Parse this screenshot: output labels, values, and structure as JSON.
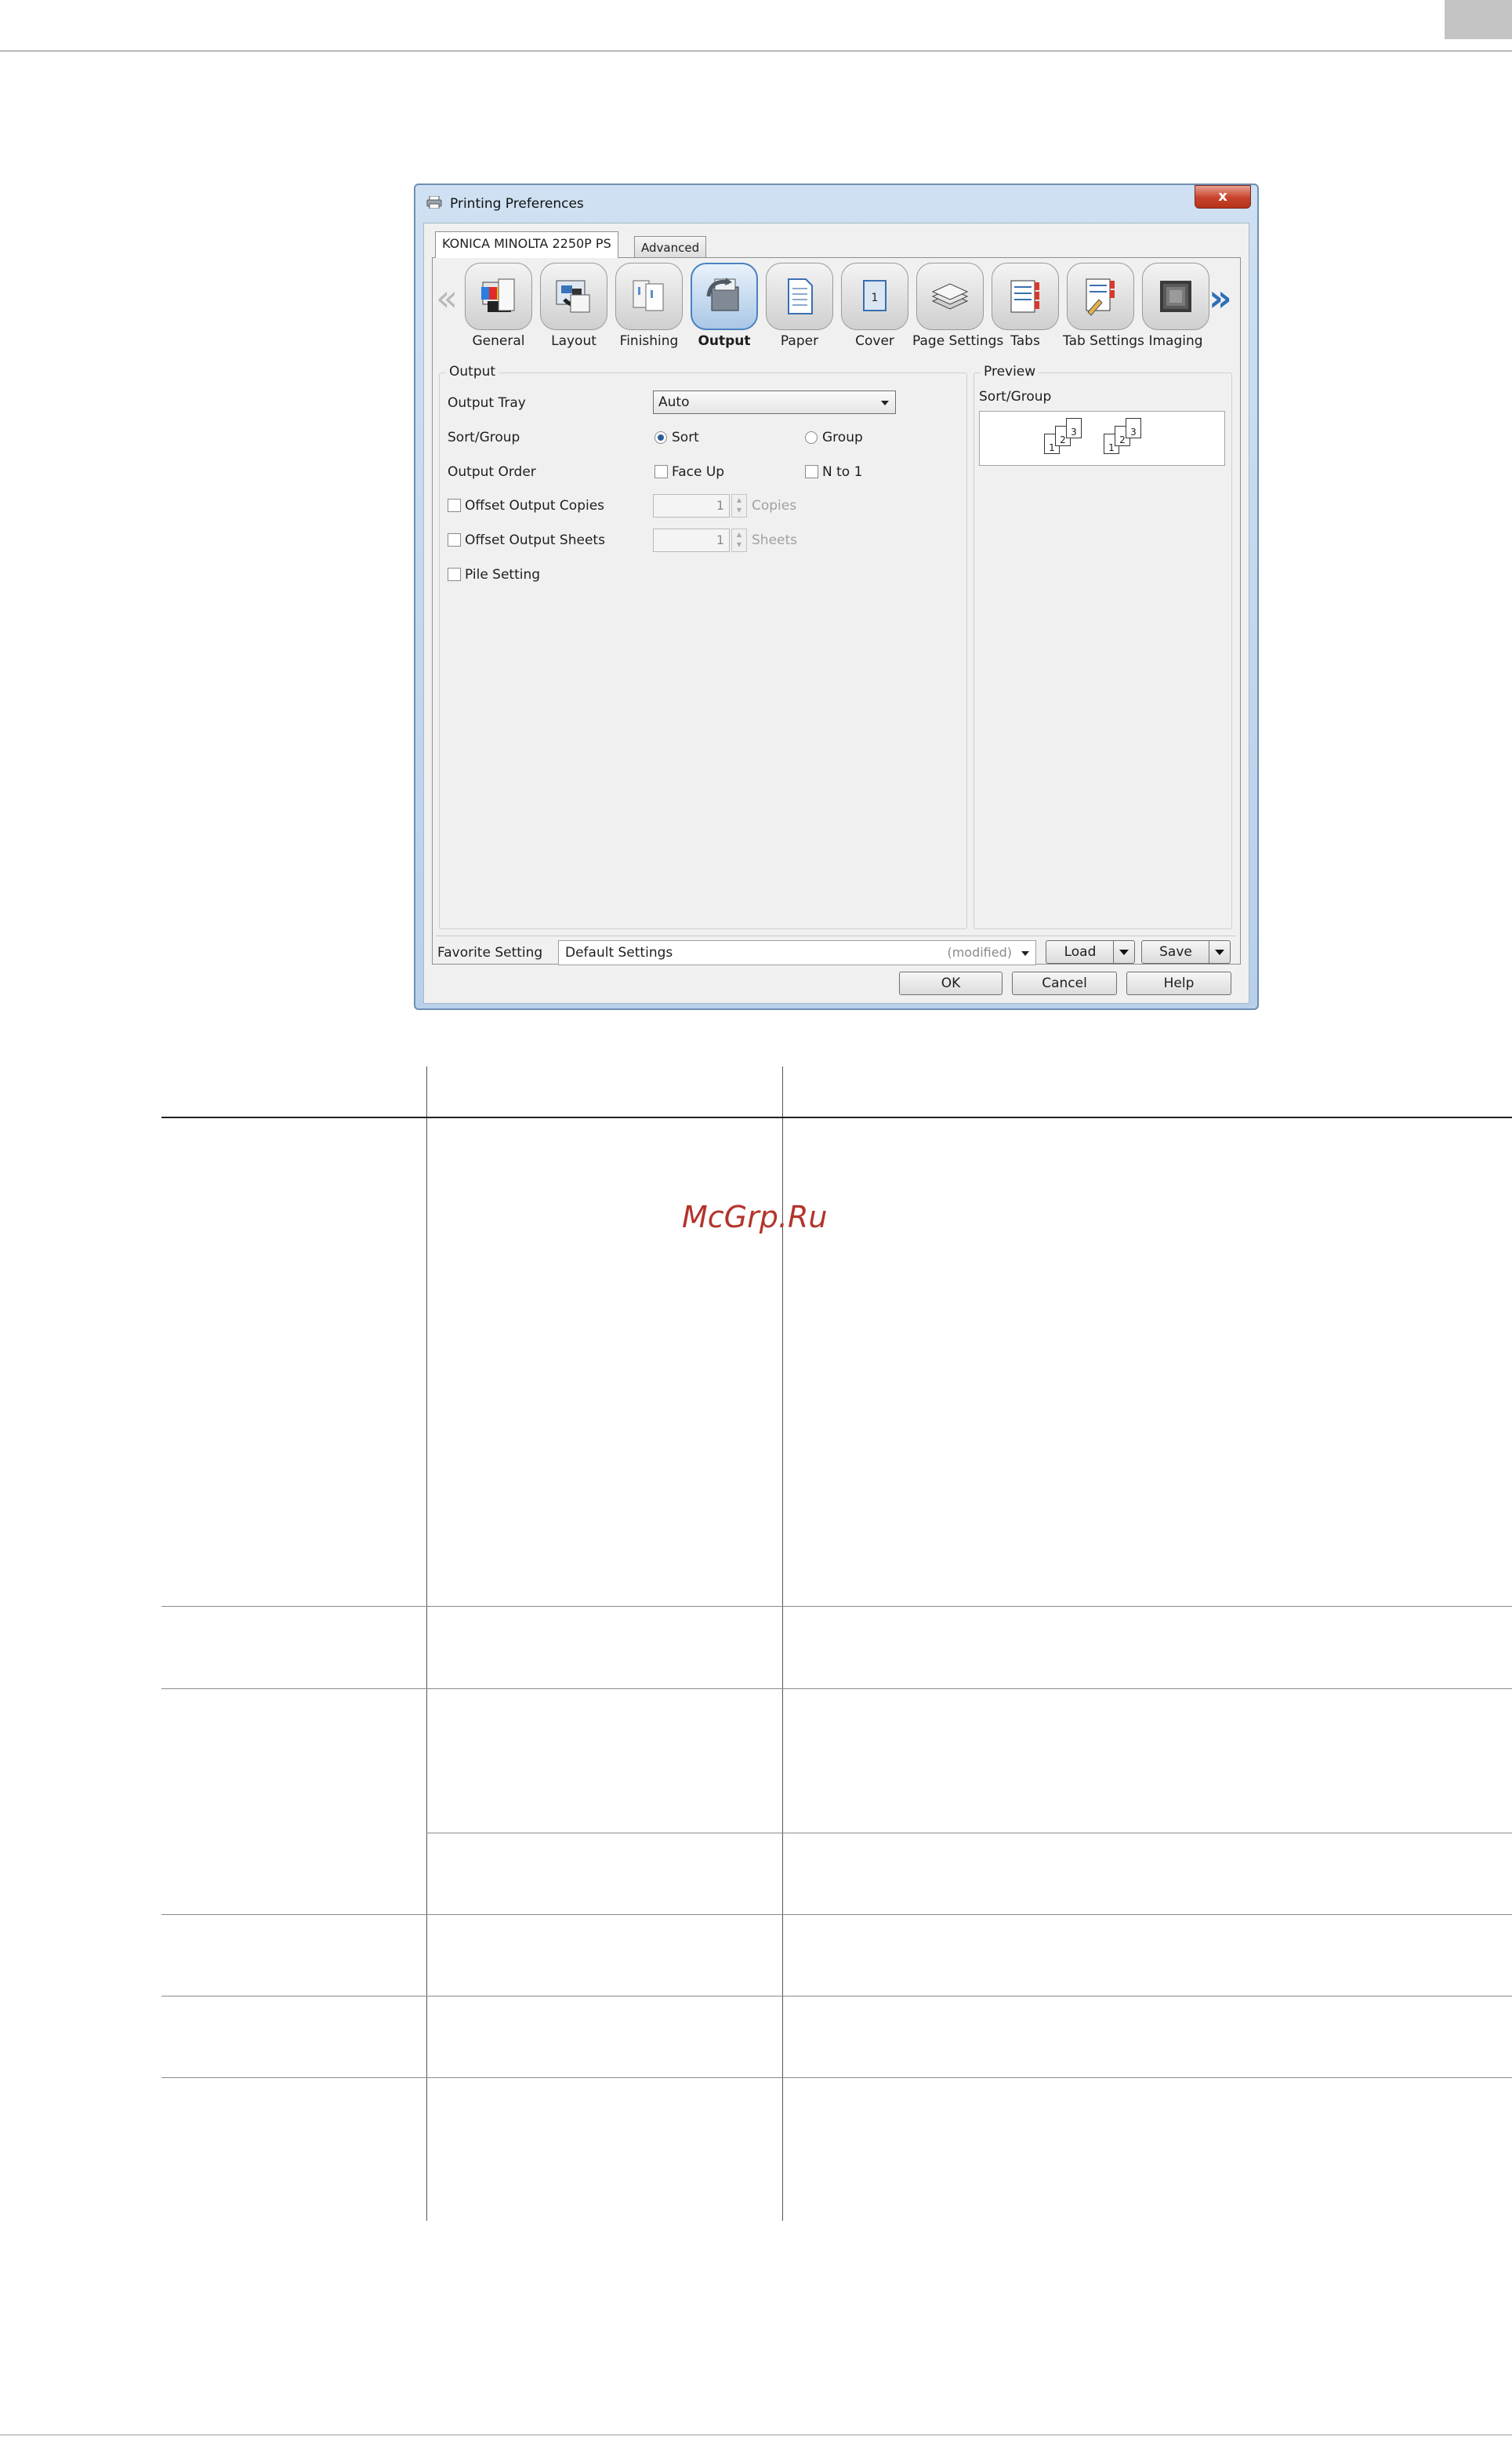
{
  "dialog": {
    "title": "Printing Preferences",
    "close_label": "x",
    "tabs": [
      "KONICA MINOLTA 2250P PS",
      "Advanced"
    ],
    "categories": [
      {
        "label": "General",
        "icon": "general-icon",
        "selected": false
      },
      {
        "label": "Layout",
        "icon": "layout-icon",
        "selected": false
      },
      {
        "label": "Finishing",
        "icon": "finishing-icon",
        "selected": false
      },
      {
        "label": "Output",
        "icon": "output-icon",
        "selected": true
      },
      {
        "label": "Paper",
        "icon": "paper-icon",
        "selected": false
      },
      {
        "label": "Cover",
        "icon": "cover-icon",
        "selected": false
      },
      {
        "label": "Page Settings",
        "icon": "page-settings-icon",
        "selected": false
      },
      {
        "label": "Tabs",
        "icon": "tabs-icon",
        "selected": false
      },
      {
        "label": "Tab Settings",
        "icon": "tab-settings-icon",
        "selected": false
      },
      {
        "label": "Imaging",
        "icon": "imaging-icon",
        "selected": false
      }
    ],
    "nav": {
      "left": "«",
      "right": "»"
    },
    "output": {
      "group_title": "Output",
      "output_tray_label": "Output Tray",
      "output_tray_value": "Auto",
      "sort_group_label": "Sort/Group",
      "sort_label": "Sort",
      "group_label": "Group",
      "output_order_label": "Output Order",
      "face_up_label": "Face Up",
      "n_to_1_label": "N to 1",
      "offset_copies_label": "Offset Output Copies",
      "offset_copies_value": "1",
      "offset_copies_unit": "Copies",
      "offset_sheets_label": "Offset Output Sheets",
      "offset_sheets_value": "1",
      "offset_sheets_unit": "Sheets",
      "pile_setting_label": "Pile Setting"
    },
    "preview": {
      "group_title": "Preview",
      "caption": "Sort/Group",
      "pages": [
        "1",
        "2",
        "3",
        "1",
        "2",
        "3"
      ]
    },
    "favorite": {
      "label": "Favorite Setting",
      "value": "Default Settings",
      "modified": "(modified)",
      "load_label": "Load",
      "save_label": "Save"
    },
    "buttons": {
      "ok": "OK",
      "cancel": "Cancel",
      "help": "Help"
    }
  },
  "watermark": "McGrp.Ru",
  "colors": {
    "accent": "#2f6fb6",
    "watermark": "#b4342c",
    "titlebar": "#cfe0f2",
    "close": "#c7422b"
  }
}
